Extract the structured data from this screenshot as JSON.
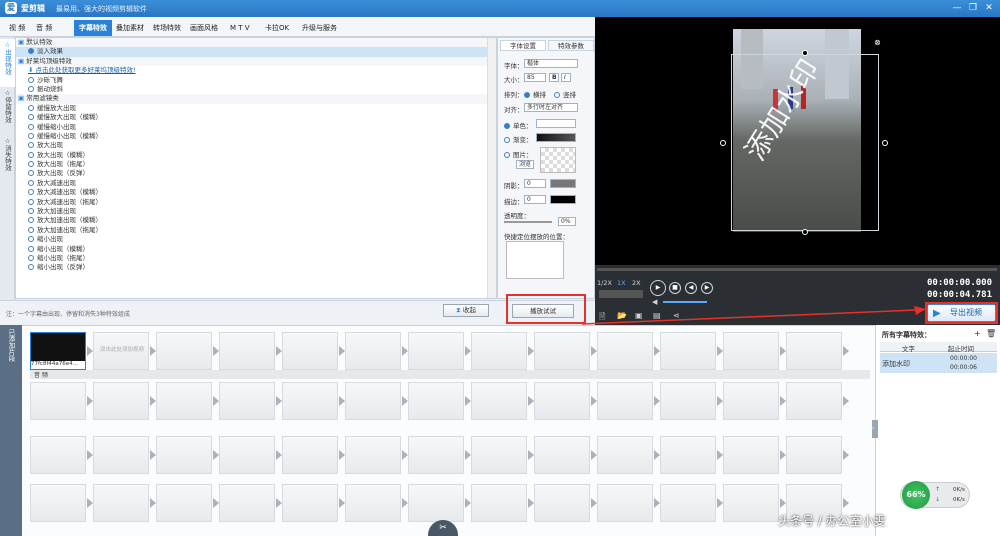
{
  "app": {
    "name": "爱剪辑",
    "slogan": "最易用、强大的视频剪辑软件",
    "logo": "爱",
    "minimize": "—",
    "restore": "❐",
    "close": "✕"
  },
  "tabs": [
    "视 频",
    "音 频",
    "字幕特效",
    "叠加素材",
    "转场特效",
    "画面风格",
    "M T V",
    "卡拉OK",
    "升级与服务"
  ],
  "sidetabs": [
    "出现特效",
    "停留特效",
    "消失特效"
  ],
  "effects": [
    {
      "t": "默认特效",
      "type": "cat"
    },
    {
      "t": "淡入效果",
      "type": "sel"
    },
    {
      "t": "好莱坞顶级特效",
      "type": "cat"
    },
    {
      "t": "点击此处获取更多好莱坞顶级特效!",
      "type": "link"
    },
    {
      "t": "沙砾飞舞",
      "type": "r"
    },
    {
      "t": "振动烧斜",
      "type": "r"
    },
    {
      "t": "常用滤镜类",
      "type": "cat"
    },
    {
      "t": "缓慢放大出现",
      "type": "r"
    },
    {
      "t": "缓慢放大出现（模糊）",
      "type": "r"
    },
    {
      "t": "缓慢缩小出现",
      "type": "r"
    },
    {
      "t": "缓慢缩小出现（模糊）",
      "type": "r"
    },
    {
      "t": "放大出现",
      "type": "r"
    },
    {
      "t": "放大出现（模糊）",
      "type": "r"
    },
    {
      "t": "放大出现（拖尾）",
      "type": "r"
    },
    {
      "t": "放大出现（反弹）",
      "type": "r"
    },
    {
      "t": "放大减速出现",
      "type": "r"
    },
    {
      "t": "放大减速出现（模糊）",
      "type": "r"
    },
    {
      "t": "放大减速出现（拖尾）",
      "type": "r"
    },
    {
      "t": "放大加速出现",
      "type": "r"
    },
    {
      "t": "放大加速出现（模糊）",
      "type": "r"
    },
    {
      "t": "放大加速出现（拖尾）",
      "type": "r"
    },
    {
      "t": "缩小出现",
      "type": "r"
    },
    {
      "t": "缩小出现（模糊）",
      "type": "r"
    },
    {
      "t": "缩小出现（拖尾）",
      "type": "r"
    },
    {
      "t": "缩小出现（反弹）",
      "type": "r"
    }
  ],
  "settings": {
    "tab1": "字体设置",
    "tab2": "特效参数",
    "font_label": "字体：",
    "font_value": "楷体",
    "size_label": "大小：",
    "size_value": "85",
    "layout_label": "排列：",
    "layout_h": "横排",
    "layout_v": "竖排",
    "align_label": "对齐：",
    "align_value": "多行时左对齐",
    "color_label": "单色：",
    "grad_label": "渐变：",
    "image_label": "图片：",
    "browse": "浏览",
    "shadow_label": "阴影：",
    "shadow_value": "0",
    "outline_label": "描边：",
    "outline_value": "0",
    "opacity_label": "透明度：",
    "opacity_value": "0%",
    "quickpos_label": "快捷定位摆放的位置："
  },
  "bottom": {
    "note": "注：一个字幕由出现、停留和消失3种特效组成",
    "collapse": "收起",
    "try": "播放试试"
  },
  "player": {
    "speed_half": "1/2X",
    "speed_1": "1X",
    "speed_2": "2X",
    "time_current": "00:00:00.000",
    "time_total": "00:00:04.781",
    "export": "导出视频"
  },
  "timeline": {
    "side_label": "已添加片段",
    "clip_name": "77fc8f44a76e4...",
    "add_hint": "双击此处添加视频",
    "audio_label": "音 频"
  },
  "subtitles": {
    "title": "所有字幕特效：",
    "col_text": "文字",
    "col_time": "起止时间",
    "row_text": "添加水印",
    "row_start": "00:00:00",
    "row_end": "00:00:06"
  },
  "speed": {
    "percent": "66%",
    "up": "0K/s",
    "down": "0K/s"
  },
  "watermark_text": "添加水印",
  "credit": "头条号 / 办公室小雯",
  "colors": {
    "accent": "#2a82d8",
    "highlight": "#e8302a",
    "titlebar": "#2a76c4"
  }
}
